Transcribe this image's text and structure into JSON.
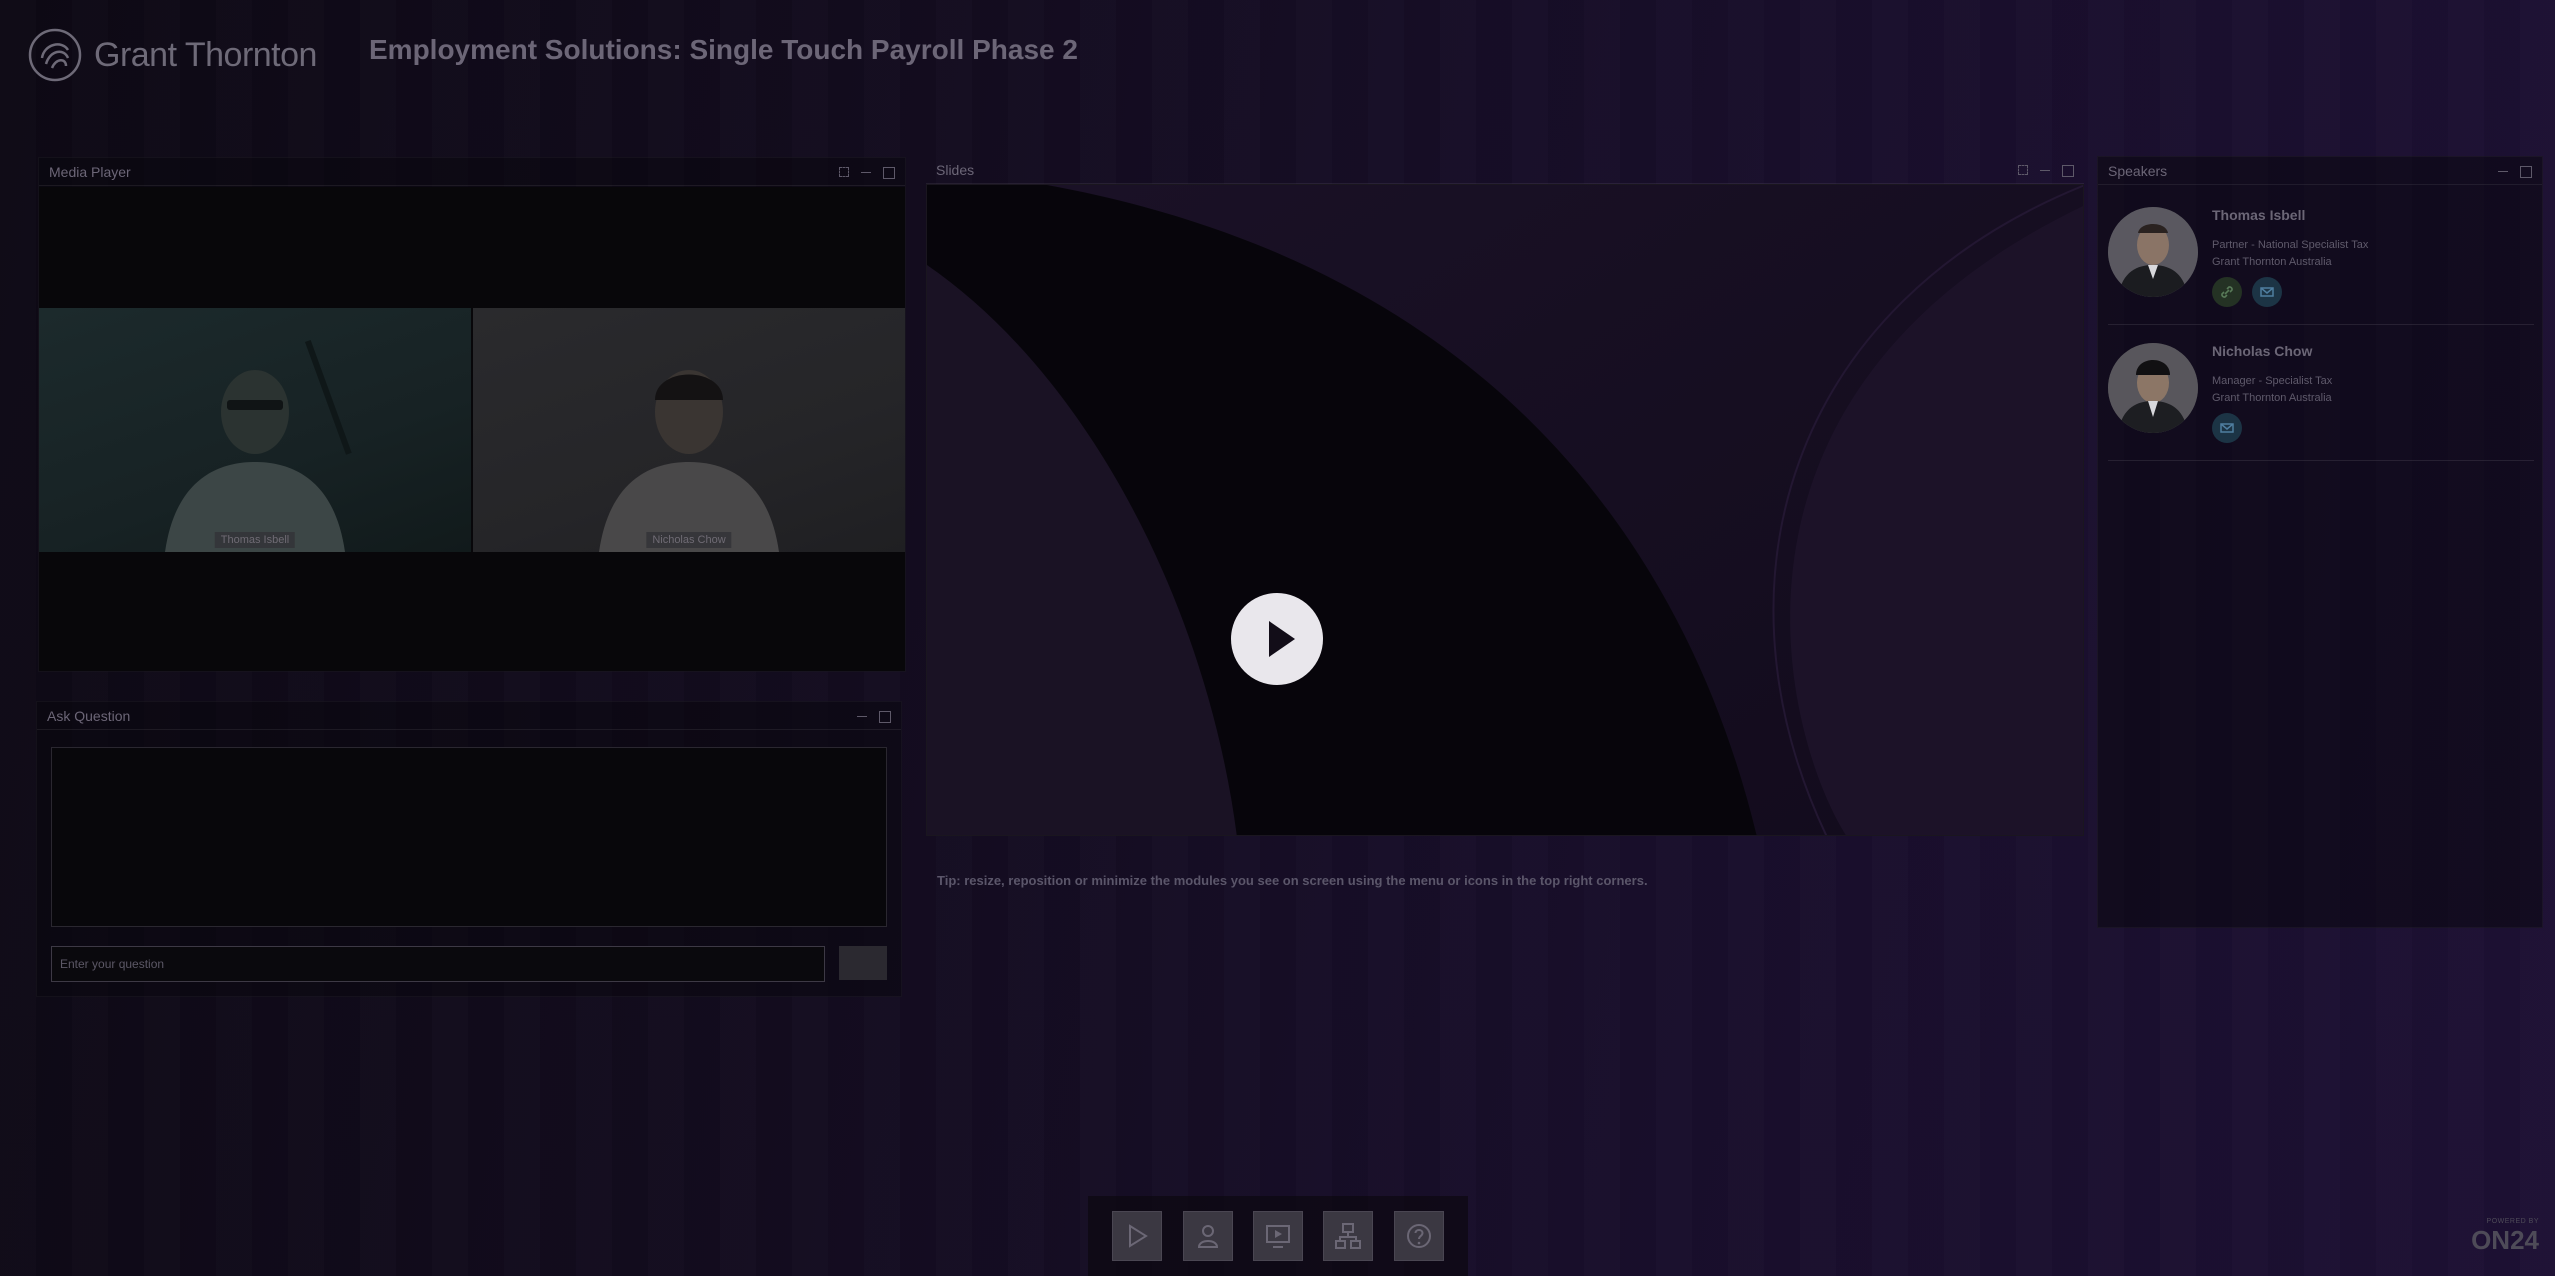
{
  "header": {
    "brand": "Grant Thornton",
    "event_title": "Employment Solutions: Single Touch Payroll Phase 2"
  },
  "media_player": {
    "title": "Media Player",
    "participants": [
      {
        "label": "Thomas Isbell"
      },
      {
        "label": "Nicholas Chow"
      }
    ]
  },
  "ask_question": {
    "title": "Ask Question",
    "input_placeholder": "Enter your question",
    "submit_label": ""
  },
  "slides": {
    "title": "Slides",
    "tip": "Tip: resize, reposition or minimize the modules you see on screen using the menu or icons in the top right corners."
  },
  "speakers": {
    "title": "Speakers",
    "items": [
      {
        "name": "Thomas Isbell",
        "role": "Partner - National Specialist Tax",
        "org": "Grant Thornton Australia",
        "icons": [
          "link-icon",
          "mail-icon"
        ]
      },
      {
        "name": "Nicholas Chow",
        "role": "Manager - Specialist Tax",
        "org": "Grant Thornton Australia",
        "icons": [
          "mail-icon"
        ]
      }
    ]
  },
  "dock": {
    "buttons": [
      "play-icon",
      "person-icon",
      "slides-icon",
      "network-icon",
      "help-icon"
    ]
  },
  "footer": {
    "powered_by": "POWERED BY",
    "platform": "ON24"
  }
}
